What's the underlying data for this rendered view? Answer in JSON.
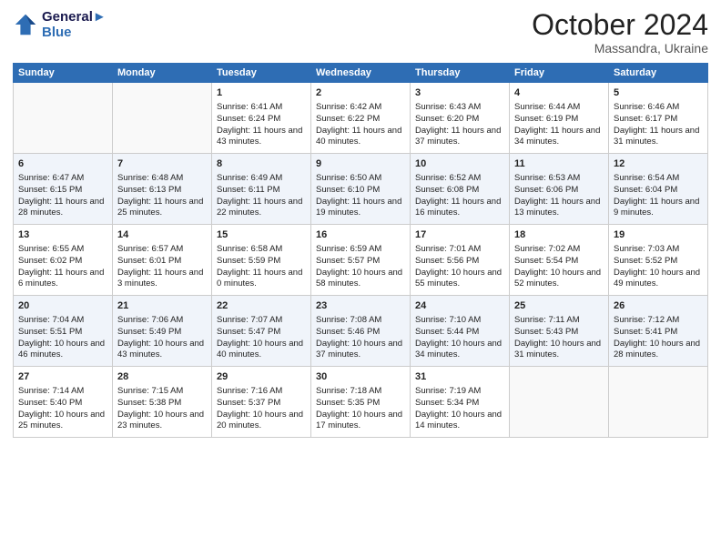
{
  "header": {
    "logo_line1": "General",
    "logo_line2": "Blue",
    "month": "October 2024",
    "location": "Massandra, Ukraine"
  },
  "days_of_week": [
    "Sunday",
    "Monday",
    "Tuesday",
    "Wednesday",
    "Thursday",
    "Friday",
    "Saturday"
  ],
  "weeks": [
    [
      {
        "day": "",
        "sunrise": "",
        "sunset": "",
        "daylight": ""
      },
      {
        "day": "",
        "sunrise": "",
        "sunset": "",
        "daylight": ""
      },
      {
        "day": "1",
        "sunrise": "Sunrise: 6:41 AM",
        "sunset": "Sunset: 6:24 PM",
        "daylight": "Daylight: 11 hours and 43 minutes."
      },
      {
        "day": "2",
        "sunrise": "Sunrise: 6:42 AM",
        "sunset": "Sunset: 6:22 PM",
        "daylight": "Daylight: 11 hours and 40 minutes."
      },
      {
        "day": "3",
        "sunrise": "Sunrise: 6:43 AM",
        "sunset": "Sunset: 6:20 PM",
        "daylight": "Daylight: 11 hours and 37 minutes."
      },
      {
        "day": "4",
        "sunrise": "Sunrise: 6:44 AM",
        "sunset": "Sunset: 6:19 PM",
        "daylight": "Daylight: 11 hours and 34 minutes."
      },
      {
        "day": "5",
        "sunrise": "Sunrise: 6:46 AM",
        "sunset": "Sunset: 6:17 PM",
        "daylight": "Daylight: 11 hours and 31 minutes."
      }
    ],
    [
      {
        "day": "6",
        "sunrise": "Sunrise: 6:47 AM",
        "sunset": "Sunset: 6:15 PM",
        "daylight": "Daylight: 11 hours and 28 minutes."
      },
      {
        "day": "7",
        "sunrise": "Sunrise: 6:48 AM",
        "sunset": "Sunset: 6:13 PM",
        "daylight": "Daylight: 11 hours and 25 minutes."
      },
      {
        "day": "8",
        "sunrise": "Sunrise: 6:49 AM",
        "sunset": "Sunset: 6:11 PM",
        "daylight": "Daylight: 11 hours and 22 minutes."
      },
      {
        "day": "9",
        "sunrise": "Sunrise: 6:50 AM",
        "sunset": "Sunset: 6:10 PM",
        "daylight": "Daylight: 11 hours and 19 minutes."
      },
      {
        "day": "10",
        "sunrise": "Sunrise: 6:52 AM",
        "sunset": "Sunset: 6:08 PM",
        "daylight": "Daylight: 11 hours and 16 minutes."
      },
      {
        "day": "11",
        "sunrise": "Sunrise: 6:53 AM",
        "sunset": "Sunset: 6:06 PM",
        "daylight": "Daylight: 11 hours and 13 minutes."
      },
      {
        "day": "12",
        "sunrise": "Sunrise: 6:54 AM",
        "sunset": "Sunset: 6:04 PM",
        "daylight": "Daylight: 11 hours and 9 minutes."
      }
    ],
    [
      {
        "day": "13",
        "sunrise": "Sunrise: 6:55 AM",
        "sunset": "Sunset: 6:02 PM",
        "daylight": "Daylight: 11 hours and 6 minutes."
      },
      {
        "day": "14",
        "sunrise": "Sunrise: 6:57 AM",
        "sunset": "Sunset: 6:01 PM",
        "daylight": "Daylight: 11 hours and 3 minutes."
      },
      {
        "day": "15",
        "sunrise": "Sunrise: 6:58 AM",
        "sunset": "Sunset: 5:59 PM",
        "daylight": "Daylight: 11 hours and 0 minutes."
      },
      {
        "day": "16",
        "sunrise": "Sunrise: 6:59 AM",
        "sunset": "Sunset: 5:57 PM",
        "daylight": "Daylight: 10 hours and 58 minutes."
      },
      {
        "day": "17",
        "sunrise": "Sunrise: 7:01 AM",
        "sunset": "Sunset: 5:56 PM",
        "daylight": "Daylight: 10 hours and 55 minutes."
      },
      {
        "day": "18",
        "sunrise": "Sunrise: 7:02 AM",
        "sunset": "Sunset: 5:54 PM",
        "daylight": "Daylight: 10 hours and 52 minutes."
      },
      {
        "day": "19",
        "sunrise": "Sunrise: 7:03 AM",
        "sunset": "Sunset: 5:52 PM",
        "daylight": "Daylight: 10 hours and 49 minutes."
      }
    ],
    [
      {
        "day": "20",
        "sunrise": "Sunrise: 7:04 AM",
        "sunset": "Sunset: 5:51 PM",
        "daylight": "Daylight: 10 hours and 46 minutes."
      },
      {
        "day": "21",
        "sunrise": "Sunrise: 7:06 AM",
        "sunset": "Sunset: 5:49 PM",
        "daylight": "Daylight: 10 hours and 43 minutes."
      },
      {
        "day": "22",
        "sunrise": "Sunrise: 7:07 AM",
        "sunset": "Sunset: 5:47 PM",
        "daylight": "Daylight: 10 hours and 40 minutes."
      },
      {
        "day": "23",
        "sunrise": "Sunrise: 7:08 AM",
        "sunset": "Sunset: 5:46 PM",
        "daylight": "Daylight: 10 hours and 37 minutes."
      },
      {
        "day": "24",
        "sunrise": "Sunrise: 7:10 AM",
        "sunset": "Sunset: 5:44 PM",
        "daylight": "Daylight: 10 hours and 34 minutes."
      },
      {
        "day": "25",
        "sunrise": "Sunrise: 7:11 AM",
        "sunset": "Sunset: 5:43 PM",
        "daylight": "Daylight: 10 hours and 31 minutes."
      },
      {
        "day": "26",
        "sunrise": "Sunrise: 7:12 AM",
        "sunset": "Sunset: 5:41 PM",
        "daylight": "Daylight: 10 hours and 28 minutes."
      }
    ],
    [
      {
        "day": "27",
        "sunrise": "Sunrise: 7:14 AM",
        "sunset": "Sunset: 5:40 PM",
        "daylight": "Daylight: 10 hours and 25 minutes."
      },
      {
        "day": "28",
        "sunrise": "Sunrise: 7:15 AM",
        "sunset": "Sunset: 5:38 PM",
        "daylight": "Daylight: 10 hours and 23 minutes."
      },
      {
        "day": "29",
        "sunrise": "Sunrise: 7:16 AM",
        "sunset": "Sunset: 5:37 PM",
        "daylight": "Daylight: 10 hours and 20 minutes."
      },
      {
        "day": "30",
        "sunrise": "Sunrise: 7:18 AM",
        "sunset": "Sunset: 5:35 PM",
        "daylight": "Daylight: 10 hours and 17 minutes."
      },
      {
        "day": "31",
        "sunrise": "Sunrise: 7:19 AM",
        "sunset": "Sunset: 5:34 PM",
        "daylight": "Daylight: 10 hours and 14 minutes."
      },
      {
        "day": "",
        "sunrise": "",
        "sunset": "",
        "daylight": ""
      },
      {
        "day": "",
        "sunrise": "",
        "sunset": "",
        "daylight": ""
      }
    ]
  ]
}
